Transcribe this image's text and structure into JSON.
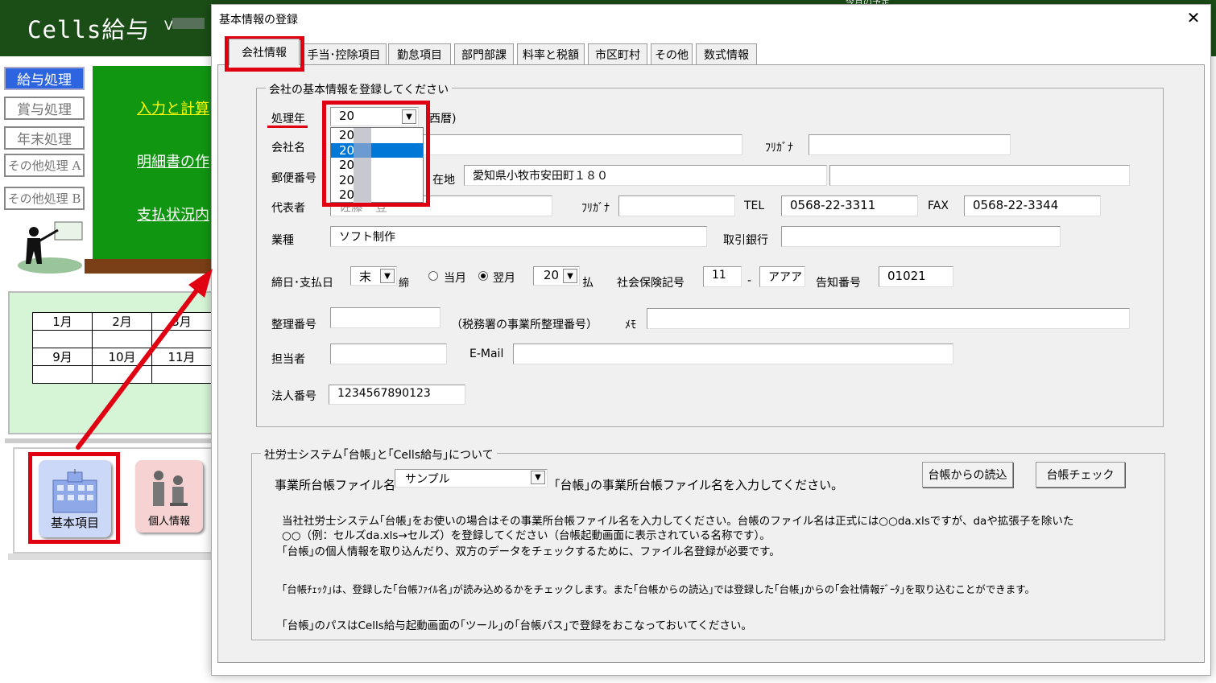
{
  "app": {
    "title": "Cells給与",
    "version_prefix": "V",
    "top_right_text": "今月の予定"
  },
  "sidebar": {
    "items": [
      {
        "label": "給与処理",
        "active": true
      },
      {
        "label": "賞与処理"
      },
      {
        "label": "年末処理"
      },
      {
        "label": "その他処理 A"
      },
      {
        "label": "その他処理 B"
      }
    ]
  },
  "green_panel": {
    "links": [
      "入力と計算",
      "明細書の作",
      "支払状況内"
    ]
  },
  "calendar": {
    "rows": [
      [
        "1月",
        "2月",
        "3月"
      ],
      [
        "",
        "",
        ""
      ],
      [
        "9月",
        "10月",
        "11月"
      ],
      [
        "",
        "",
        ""
      ]
    ]
  },
  "bottom_buttons": {
    "kihon": "基本項目",
    "kojin": "個人情報"
  },
  "dialog": {
    "title": "基本情報の登録",
    "close_glyph": "✕",
    "tabs": [
      "会社情報",
      "手当･控除項目",
      "勤怠項目",
      "部門部課",
      "料率と税額",
      "市区町村",
      "その他",
      "数式情報"
    ],
    "group1_title": "会社の基本情報を登録してください",
    "year": {
      "label": "処理年",
      "value": "20",
      "suffix": "西暦)"
    },
    "year_dropdown": [
      "20",
      "20",
      "20",
      "20",
      "20"
    ],
    "company": {
      "name_label": "会社名",
      "name": "",
      "kana_label": "ﾌﾘｶﾞﾅ",
      "kana": ""
    },
    "address": {
      "zip_label": "郵便番号",
      "addr_label": "在地",
      "addr1": "愛知県小牧市安田町１８０",
      "addr2": ""
    },
    "rep": {
      "label": "代表者",
      "name": "佐藤　登",
      "kana_label": "ﾌﾘｶﾞﾅ",
      "kana": "",
      "tel_label": "TEL",
      "tel": "0568-22-3311",
      "fax_label": "FAX",
      "fax": "0568-22-3344"
    },
    "industry": {
      "label": "業種",
      "value": "ソフト制作",
      "bank_label": "取引銀行",
      "bank": ""
    },
    "closing": {
      "label": "締日･支払日",
      "close_value": "末",
      "close_suffix": "締",
      "radio1": "当月",
      "radio2": "翌月",
      "pay_value": "20",
      "pay_suffix": "払",
      "ins_label": "社会保険記号",
      "ins1": "11",
      "dash": "-",
      "ins2": "アアア",
      "notice_label": "告知番号",
      "notice": "01021"
    },
    "seiri": {
      "label": "整理番号",
      "value": "",
      "hint": "（税務署の事業所整理番号）",
      "memo_label": "ﾒﾓ",
      "memo": ""
    },
    "tanto": {
      "label": "担当者",
      "value": "",
      "email_label": "E-Mail",
      "email": ""
    },
    "corp_no": {
      "label": "法人番号",
      "value": "1234567890123"
    },
    "group2_title": "社労士システム｢台帳｣と｢Cells給与｣について",
    "ledger": {
      "label": "事業所台帳ファイル名",
      "value": "サンプル",
      "hint": "｢台帳｣の事業所台帳ファイル名を入力してください。",
      "btn_read": "台帳からの読込",
      "btn_check": "台帳チェック"
    },
    "notes": [
      "当社社労士システム｢台帳｣をお使いの場合はその事業所台帳ファイル名を入力してください。台帳のファイル名は正式には○○da.xlsですが、daや拡張子を除いた",
      "○○（例：セルズda.xls→セルズ）を登録してください（台帳起動画面に表示されている名称です）。",
      "｢台帳｣の個人情報を取り込んだり、双方のデータをチェックするために、ファイル名登録が必要です。",
      "｢台帳ﾁｪｯｸ｣は、登録した｢台帳ﾌｧｲﾙ名｣が読み込めるかをチェックします。また｢台帳からの読込｣では登録した｢台帳｣からの｢会社情報ﾃﾞｰﾀ｣を取り込むことができます。",
      "｢台帳｣のパスはCells給与起動画面の｢ツール｣の｢台帳パス｣で登録をおこなっておいてください。"
    ]
  },
  "colors": {
    "header_green": "#1b4d16",
    "panel_green": "#119611",
    "highlight_red": "#e00012",
    "select_blue": "#0078d7"
  }
}
